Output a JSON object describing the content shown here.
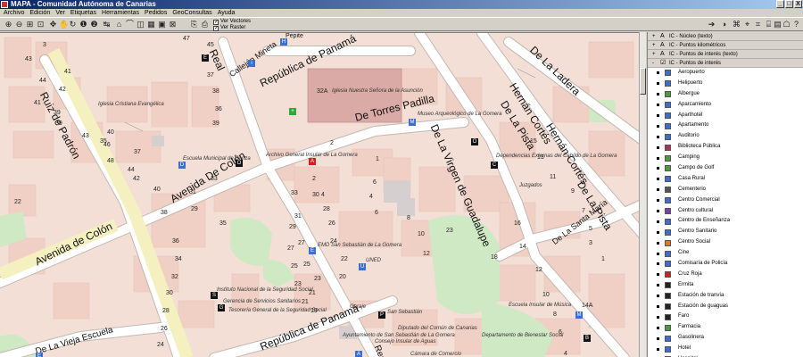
{
  "window": {
    "title": "MAPA - Comunidad Autónoma de Canarias",
    "buttons": [
      "_",
      "□",
      "X"
    ]
  },
  "menu": [
    "Archivo",
    "Edición",
    "Ver",
    "Etiquetas",
    "Herramientas",
    "Pedidos",
    "GeoConsultas",
    "Ayuda"
  ],
  "toolbar": {
    "tools": [
      "zoom-in-icon",
      "zoom-out-icon",
      "zoom-box-icon",
      "zoom-full-icon",
      "pan-icon",
      "hand-icon",
      "refresh-icon",
      "info-icon",
      "info2-icon",
      "measure-icon",
      "area-icon",
      "profile-icon",
      "buffer-icon",
      "terrain-icon",
      "pano-icon",
      "select-icon",
      "copy-icon",
      "print-icon"
    ],
    "checks": [
      {
        "label": "Ver Vectores",
        "checked": true
      },
      {
        "label": "Ver Raster",
        "checked": true
      }
    ],
    "right_tools": [
      "arrow-icon",
      "tool-a",
      "tool-b",
      "tool-c",
      "tool-d",
      "tool-e",
      "tool-f",
      "tool-g",
      "tool-h",
      "help-icon"
    ]
  },
  "map": {
    "streets": [
      {
        "name": "Ruiz de Padrón"
      },
      {
        "name": "Real"
      },
      {
        "name": "Callejón Mineta"
      },
      {
        "name": "República de Panamá"
      },
      {
        "name": "De Torres Padilla"
      },
      {
        "name": "Hernán Cortés"
      },
      {
        "name": "De La Ladera"
      },
      {
        "name": "De La Pista"
      },
      {
        "name": "Hernán Cortés"
      },
      {
        "name": "De La Pista"
      },
      {
        "name": "De La Virgen de Guadalupe"
      },
      {
        "name": "Avenida De Colón"
      },
      {
        "name": "Avenida de Colón"
      },
      {
        "name": "De La Santa María"
      },
      {
        "name": "República de Panamá"
      },
      {
        "name": "De La Vieja Escuela"
      },
      {
        "name": "Real"
      },
      {
        "name": "Pepite"
      }
    ],
    "poi_labels": [
      "Iglesia Nuestra Señora de la Asunción",
      "Iglesia Cristiana Evangélica",
      "Museo Arqueológico de La Gomera",
      "Dependencias Externas del Cabildo de La Gomera",
      "Escuela Municipal de Danza",
      "Archivo General Insular de La Gomera",
      "Juzgados",
      "EMD San Sebastián de La Gomera",
      "UNED",
      "Instituto Nacional de la Seguridad Social",
      "Gerencia de Servicios Sanitarios",
      "Tesorería General de la Seguridad Social",
      "Garaje",
      "San Sebastián",
      "Escuela Insular de Música",
      "Diputado del Común de Canarias",
      "Ayuntamiento de San Sebastián de La Gomera",
      "Departamento de Bienestar Social",
      "Consejo Insular de Aguas",
      "Cámara de Comercio"
    ],
    "numbers": [
      "47",
      "45",
      "43",
      "3",
      "41",
      "44",
      "42",
      "41",
      "39",
      "39",
      "43",
      "35",
      "46",
      "48",
      "40",
      "37",
      "44",
      "42",
      "40",
      "38",
      "36",
      "34",
      "32",
      "30",
      "28",
      "26",
      "24",
      "22",
      "39",
      "38",
      "37",
      "36",
      "35",
      "33",
      "31",
      "29",
      "27",
      "25",
      "23",
      "21",
      "32A",
      "2",
      "1",
      "6",
      "4",
      "2",
      "30",
      "28",
      "26",
      "24",
      "22",
      "20",
      "33",
      "31",
      "29",
      "27",
      "25",
      "23",
      "21",
      "19",
      "4",
      "6",
      "8",
      "10",
      "12",
      "23",
      "14A",
      "16",
      "14",
      "12",
      "10",
      "8",
      "6",
      "4",
      "2",
      "18",
      "15",
      "13",
      "11",
      "9",
      "7",
      "5",
      "3",
      "1"
    ]
  },
  "layers": {
    "groups": [
      {
        "label": "IC - Núcleo (texto)"
      },
      {
        "label": "IC - Puntos kilométricos"
      },
      {
        "label": "IC - Puntos de interés (texto)"
      },
      {
        "label": "IC - Puntos de interés"
      }
    ],
    "items": [
      {
        "label": "Aeropuerto",
        "color": "#3a6fd0"
      },
      {
        "label": "Helipuerto",
        "color": "#3a6fd0"
      },
      {
        "label": "Albergue",
        "color": "#4b9a3c"
      },
      {
        "label": "Aparcamiento",
        "color": "#3a6fd0"
      },
      {
        "label": "Aparthotel",
        "color": "#3a6fd0"
      },
      {
        "label": "Apartamento",
        "color": "#3a6fd0"
      },
      {
        "label": "Auditorio",
        "color": "#3a6fd0"
      },
      {
        "label": "Biblioteca Pública",
        "color": "#b0305a"
      },
      {
        "label": "Camping",
        "color": "#4b9a3c"
      },
      {
        "label": "Campo de Golf",
        "color": "#4b9a3c"
      },
      {
        "label": "Casa Rural",
        "color": "#3a6fd0"
      },
      {
        "label": "Cementerio",
        "color": "#555555"
      },
      {
        "label": "Centro Comercial",
        "color": "#3a6fd0"
      },
      {
        "label": "Centro cultural",
        "color": "#7a3fb0"
      },
      {
        "label": "Centro de Enseñanza",
        "color": "#3a6fd0"
      },
      {
        "label": "Centro Sanitario",
        "color": "#3a6fd0"
      },
      {
        "label": "Centro Social",
        "color": "#e07a1f"
      },
      {
        "label": "Cine",
        "color": "#3a6fd0"
      },
      {
        "label": "Comisaría de Policía",
        "color": "#3a6fd0"
      },
      {
        "label": "Cruz Roja",
        "color": "#d02020"
      },
      {
        "label": "Ermita",
        "color": "#222222"
      },
      {
        "label": "Estación de tranvía",
        "color": "#222222"
      },
      {
        "label": "Estación de guaguas",
        "color": "#222222"
      },
      {
        "label": "Faro",
        "color": "#222222"
      },
      {
        "label": "Farmacia",
        "color": "#4b9a3c"
      },
      {
        "label": "Gasolinera",
        "color": "#3a6fd0"
      },
      {
        "label": "Hotel",
        "color": "#3a6fd0"
      },
      {
        "label": "Hospital",
        "color": "#3a6fd0"
      }
    ]
  }
}
